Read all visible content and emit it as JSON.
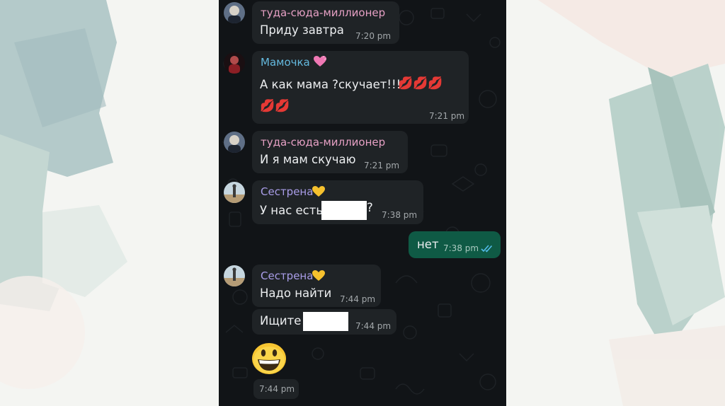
{
  "colors": {
    "chat_background": "#111417",
    "incoming_bubble": "#1f2326",
    "outgoing_bubble": "#0f5a45",
    "sender_millioner": "#e6a0c4",
    "sender_mamochka": "#64b9de",
    "sender_sestrena": "#a99de8",
    "read_ticks": "#53bdeb"
  },
  "messages": [
    {
      "sender": "туда-сюда-миллионер",
      "text": "Приду завтра",
      "time": "7:20 pm",
      "direction": "incoming",
      "avatar": "avatar-icon"
    },
    {
      "sender": "Мамочка",
      "sender_badge": "heart-icon",
      "text_line1": "А как мама ?скучает!!!",
      "emoji_line1": "💋💋💋",
      "emoji_line2": "💋💋",
      "time": "7:21 pm",
      "direction": "incoming",
      "avatar": "avatar-icon"
    },
    {
      "sender": "туда-сюда-миллионер",
      "text": "И я мам скучаю",
      "time": "7:21 pm",
      "direction": "incoming",
      "avatar": "avatar-icon"
    },
    {
      "sender": "Сестрена",
      "sender_badge": "yellow-heart-icon",
      "text_before": "У нас есть",
      "text_after": "?",
      "redacted": true,
      "time": "7:38 pm",
      "direction": "incoming",
      "avatar": "avatar-icon"
    },
    {
      "text": "нет",
      "time": "7:38 pm",
      "direction": "outgoing",
      "status": "read-double-check-icon"
    },
    {
      "sender": "Сестрена",
      "sender_badge": "yellow-heart-icon",
      "text": "Надо найти",
      "time": "7:44 pm",
      "direction": "incoming",
      "avatar": "avatar-icon"
    },
    {
      "text": "Ищите",
      "redacted": true,
      "time": "7:44 pm",
      "direction": "incoming"
    },
    {
      "emoji": "grinning-face-icon",
      "time": "7:44 pm",
      "direction": "incoming"
    }
  ]
}
